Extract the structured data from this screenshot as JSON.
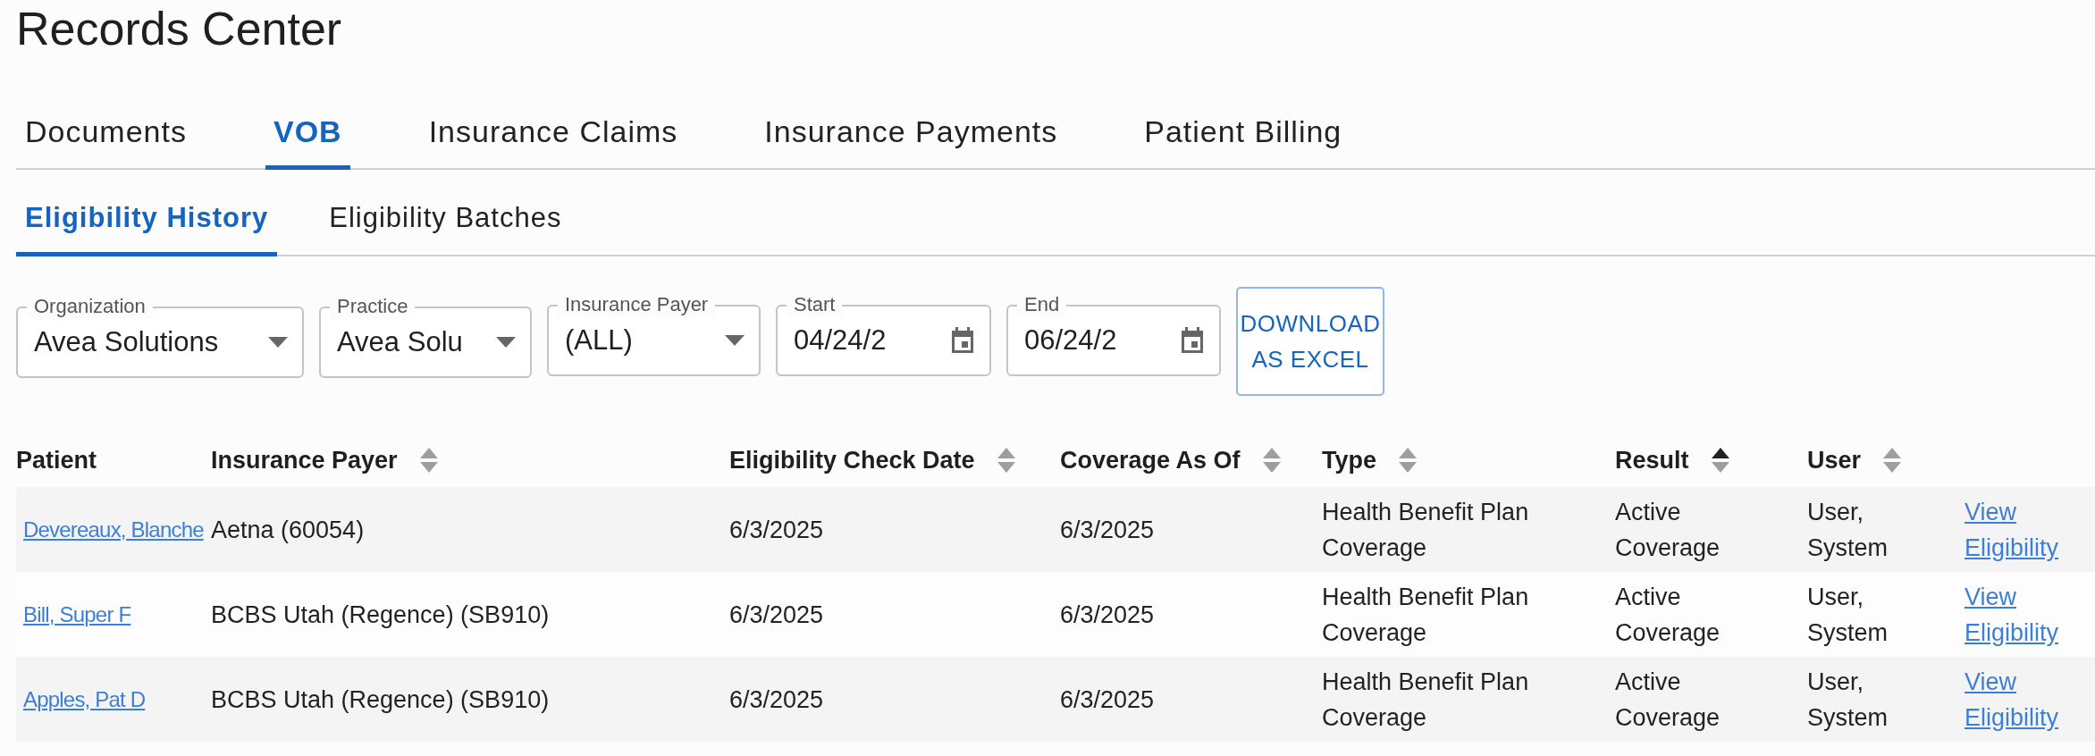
{
  "page_title": "Records Center",
  "tabs": [
    {
      "label": "Documents",
      "selected": false
    },
    {
      "label": "VOB",
      "selected": true
    },
    {
      "label": "Insurance Claims",
      "selected": false
    },
    {
      "label": "Insurance Payments",
      "selected": false
    },
    {
      "label": "Patient Billing",
      "selected": false
    }
  ],
  "subtabs": [
    {
      "label": "Eligibility History",
      "selected": true
    },
    {
      "label": "Eligibility Batches",
      "selected": false
    }
  ],
  "filters": [
    {
      "kind": "select",
      "label": "Organization",
      "value": "Avea Solutions"
    },
    {
      "kind": "select",
      "label": "Practice",
      "value": "Avea Solu"
    },
    {
      "kind": "select",
      "label": "Insurance Payer",
      "value": "(ALL)"
    },
    {
      "kind": "date",
      "label": "Start",
      "value": "04/24/2"
    },
    {
      "kind": "date",
      "label": "End",
      "value": "06/24/2"
    }
  ],
  "download_button": "DOWNLOAD AS EXCEL",
  "table": {
    "columns": [
      {
        "label": "Patient"
      },
      {
        "label": "Insurance Payer",
        "sorted": false
      },
      {
        "label": "Eligibility Check Date",
        "sorted": false
      },
      {
        "label": "Coverage As Of",
        "sorted": false
      },
      {
        "label": "Type",
        "sorted": false
      },
      {
        "label": "Result",
        "sorted": true
      },
      {
        "label": "User",
        "sorted": false
      }
    ],
    "rows": [
      {
        "patient": "Devereaux, Blanche",
        "payer": "Aetna (60054)",
        "check_date": "6/3/2025",
        "coverage_as_of": "6/3/2025",
        "type": "Health Benefit Plan Coverage",
        "result": "Active Coverage",
        "user": "User, System",
        "action": "View Eligibility"
      },
      {
        "patient": "Bill, Super F",
        "payer": "BCBS Utah (Regence) (SB910)",
        "check_date": "6/3/2025",
        "coverage_as_of": "6/3/2025",
        "type": "Health Benefit Plan Coverage",
        "result": "Active Coverage",
        "user": "User, System",
        "action": "View Eligibility"
      },
      {
        "patient": "Apples, Pat D",
        "payer": "BCBS Utah (Regence) (SB910)",
        "check_date": "6/3/2025",
        "coverage_as_of": "6/3/2025",
        "type": "Health Benefit Plan Coverage",
        "result": "Active Coverage",
        "user": "User, System",
        "action": "View Eligibility"
      }
    ]
  }
}
